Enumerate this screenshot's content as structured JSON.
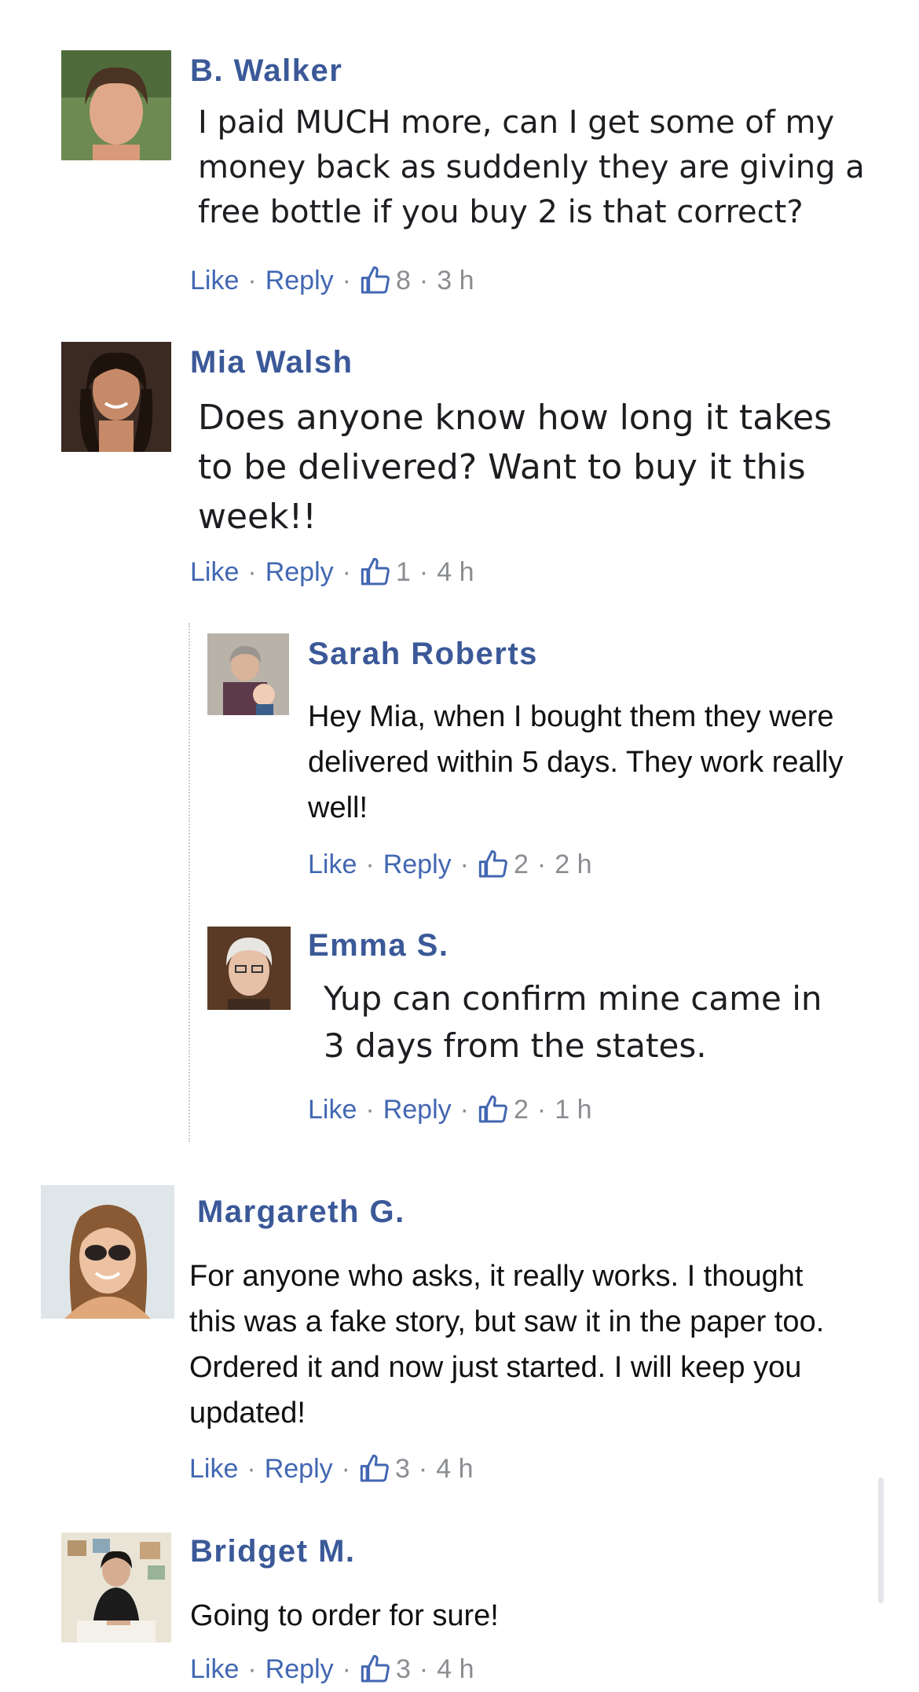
{
  "comments": [
    {
      "name": "B. Walker",
      "text": "I paid MUCH more, can I get some of my money back as suddenly they are giving a free bottle if you buy 2 is that correct?",
      "like_label": "Like",
      "reply_label": "Reply",
      "likes": "8",
      "time": "3 h"
    },
    {
      "name": "Mia Walsh",
      "text": "Does anyone know how long it takes to be delivered? Want to buy it this week!!",
      "like_label": "Like",
      "reply_label": "Reply",
      "likes": "1",
      "time": "4 h"
    },
    {
      "name": "Sarah Roberts",
      "text": "Hey Mia, when I bought them they were delivered within 5 days. They work really well!",
      "like_label": "Like",
      "reply_label": "Reply",
      "likes": "2",
      "time": "2 h"
    },
    {
      "name": "Emma S.",
      "text": "Yup can confirm mine came in 3 days from the states.",
      "like_label": "Like",
      "reply_label": "Reply",
      "likes": "2",
      "time": "1 h"
    },
    {
      "name": "Margareth G.",
      "text": "For anyone who asks, it really works. I thought this was a fake story, but saw it in the paper too. Ordered it and now just started. I will keep you updated!",
      "like_label": "Like",
      "reply_label": "Reply",
      "likes": "3",
      "time": "4 h"
    },
    {
      "name": "Bridget M.",
      "text": "Going to order for sure!",
      "like_label": "Like",
      "reply_label": "Reply",
      "likes": "3",
      "time": "4 h"
    }
  ],
  "colors": {
    "name": "#3b5998",
    "link": "#4267b2",
    "meta": "#8a8d91",
    "text": "#1c1e21"
  },
  "icons": {
    "like": "thumbs-up-icon"
  }
}
